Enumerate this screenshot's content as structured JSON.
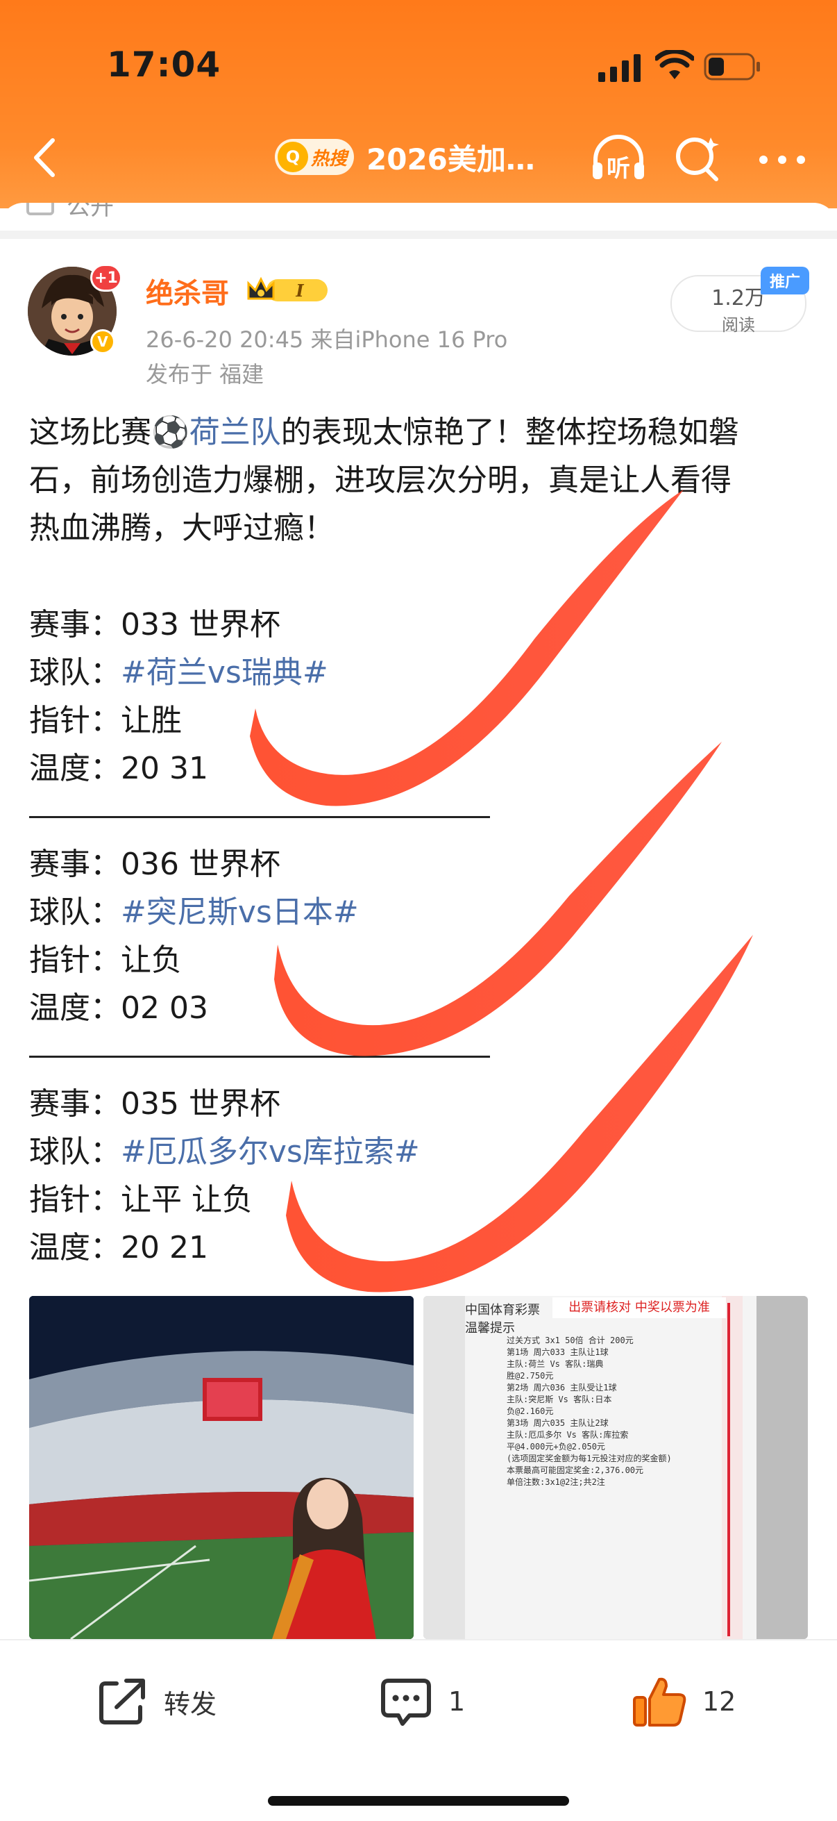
{
  "status_bar": {
    "time": "17:04"
  },
  "nav": {
    "hot_badge": "热搜",
    "title": "2026美加…",
    "icons": [
      "back-icon",
      "listen-icon",
      "search-icon",
      "more-icon"
    ]
  },
  "prev_row": {
    "label": "公开"
  },
  "post": {
    "username": "绝杀哥",
    "avatar_badge": "+1",
    "verify_badge": "V",
    "member_level": "I",
    "meta_line": "26-6-20 20:45  来自iPhone 16 Pro",
    "location_line": "发布于 福建",
    "reads": "1.2万",
    "reads_label": "阅读",
    "promo_tag": "推广",
    "intro_line1": "这场比赛",
    "intro_link": "⚽荷兰队",
    "intro_line1_tail": "的表现太惊艳了！整体控场稳如磐",
    "intro_line2": "石，前场创造力爆棚，进攻层次分明，真是让人看得",
    "intro_line3": "热血沸腾，大呼过瘾！",
    "matches": [
      {
        "event_label": "赛事：",
        "event": "033 世界杯",
        "team_label": "球队：",
        "team": "#荷兰vs瑞典#",
        "pick_label": "指针：",
        "pick": "让胜",
        "temp_label": "温度：",
        "temp": "20 31"
      },
      {
        "event_label": "赛事：",
        "event": "036 世界杯",
        "team_label": "球队：",
        "team": "#突尼斯vs日本#",
        "pick_label": "指针：",
        "pick": "让负",
        "temp_label": "温度：",
        "temp": "02 03"
      },
      {
        "event_label": "赛事：",
        "event": "035 世界杯",
        "team_label": "球队：",
        "team": "#厄瓜多尔vs库拉索#",
        "pick_label": "指针：",
        "pick": "让平 让负",
        "temp_label": "温度：",
        "temp": "20 21"
      }
    ]
  },
  "ticket": {
    "header_left": "中国体育彩票",
    "header_sub": "温馨提示",
    "header_notice": "出票请核对  中奖以票为准",
    "lines": [
      "过关方式 3x1        50倍        合计 200元",
      "第1场  周六033   主队让1球",
      "主队:荷兰  Vs  客队:瑞典",
      "胜@2.750元",
      "第2场  周六036   主队受让1球",
      "主队:突尼斯  Vs  客队:日本",
      "负@2.160元",
      "第3场  周六035   主队让2球",
      "主队:厄瓜多尔  Vs  客队:库拉索",
      "平@4.000元+负@2.050元",
      "(选项固定奖金额为每1元投注对应的奖金额)",
      "本票最高可能固定奖金:2,376.00元",
      "单倍注数:3x1@2注;共2注"
    ]
  },
  "actions": {
    "repost": "转发",
    "comments": "1",
    "likes": "12"
  },
  "colors": {
    "header_orange": "#ff7a1a",
    "username_orange": "#ff6d1a",
    "link_blue": "#4a6ea9",
    "check_red": "#ff3b1f"
  }
}
